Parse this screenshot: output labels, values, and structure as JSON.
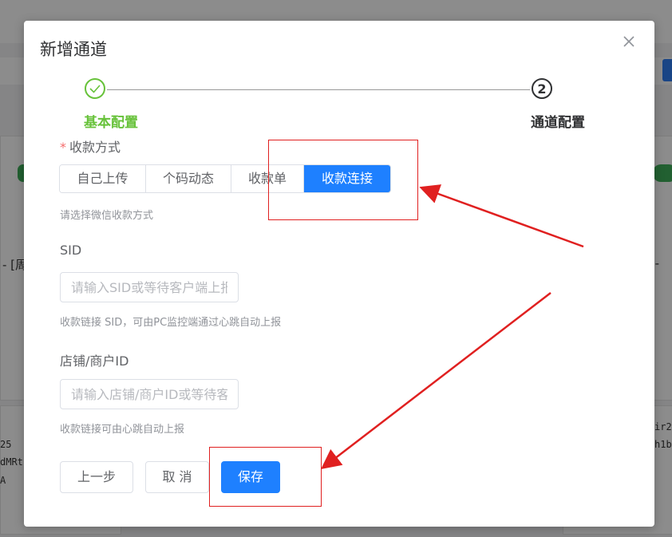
{
  "background": {
    "left_text": "- [周",
    "right_text": "t -",
    "left_code": [
      "25",
      "dMRt",
      "A"
    ],
    "right_code": [
      "ir2",
      "h1b"
    ]
  },
  "dialog": {
    "title": "新增通道",
    "close_icon": "close-icon",
    "steps": [
      {
        "index_icon": "check-icon",
        "label": "基本配置",
        "status": "finished"
      },
      {
        "index": "2",
        "label": "通道配置",
        "status": "active"
      }
    ],
    "payment_method": {
      "required_mark": "*",
      "label": "收款方式",
      "options": [
        "自己上传",
        "个码动态",
        "收款单",
        "收款连接"
      ],
      "selected": "收款连接",
      "hint": "请选择微信收款方式"
    },
    "sid": {
      "label": "SID",
      "placeholder": "请输入SID或等待客户端上报",
      "value": "",
      "hint": "收款链接 SID，可由PC监控端通过心跳自动上报"
    },
    "store_id": {
      "label": "店铺/商户ID",
      "placeholder": "请输入店铺/商户ID或等待客户端上报",
      "value": "",
      "hint": "收款链接可由心跳自动上报"
    },
    "buttons": {
      "prev": "上一步",
      "cancel": "取 消",
      "save": "保存"
    }
  },
  "colors": {
    "primary": "#1e80ff",
    "success": "#67c23a",
    "annotation": "#e02020"
  }
}
